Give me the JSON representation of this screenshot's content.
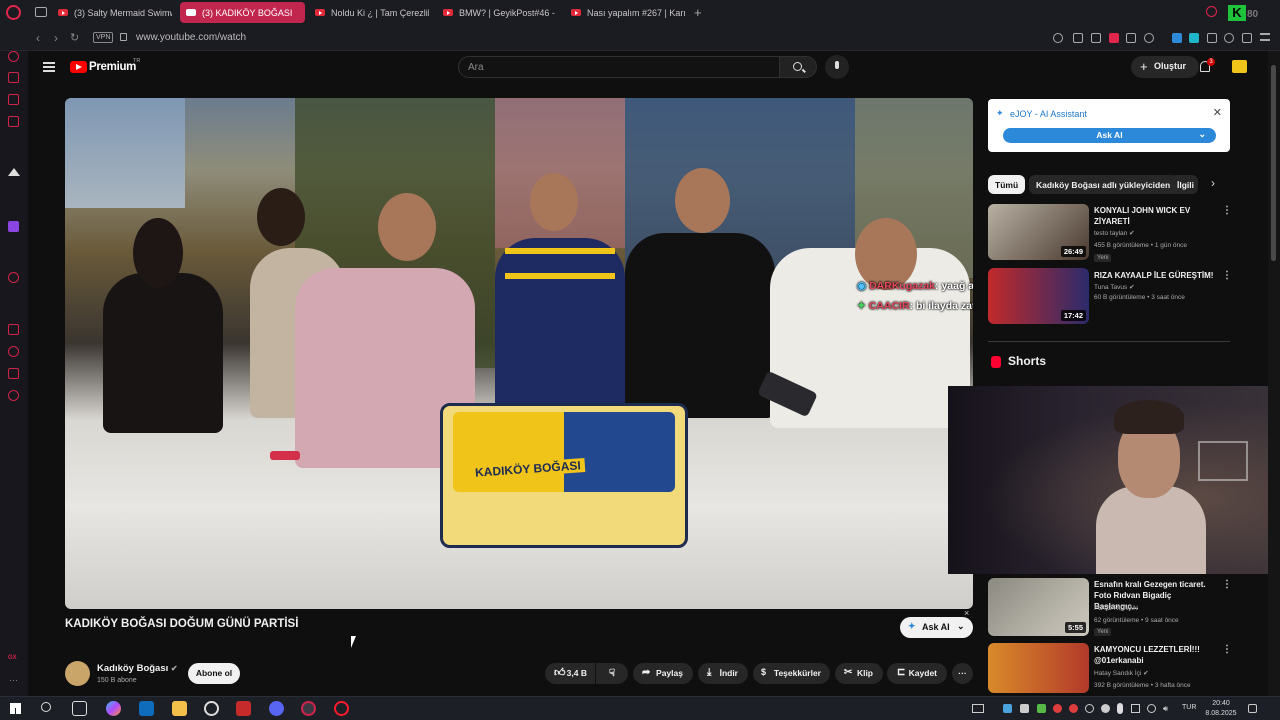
{
  "browser": {
    "tabs": [
      {
        "label": "(3) Salty Mermaid Swimw",
        "active": false
      },
      {
        "label": "(3) KADIKÖY BOĞASI",
        "active": true
      },
      {
        "label": "Noldu Ki ¿ | Tam Çerezlik",
        "active": false
      },
      {
        "label": "BMW? | GeyikPost#46 - Y",
        "active": false
      },
      {
        "label": "Nası yapalım #267 | Karış",
        "active": false
      }
    ],
    "vpn_label": "VPN",
    "url": "www.youtube.com/watch"
  },
  "youtube": {
    "logo_text": "Premium",
    "logo_region": "TR",
    "search_placeholder": "Ara",
    "create_label": "Oluştur",
    "notification_count": "3"
  },
  "video": {
    "title": "KADIKÖY BOĞASI DOĞUM GÜNÜ PARTİSİ",
    "cake_text": "KADIKÖY BOĞASI",
    "chat": [
      {
        "user": "DARKugazak",
        "message": ": yaağ ali koç"
      },
      {
        "user": "CAACIR",
        "message": ": bi ilayda zaten misafir amk müstafası"
      }
    ],
    "ask_ai_label": "Ask AI"
  },
  "channel": {
    "name": "Kadıköy Boğası",
    "subscribers": "150 B abone",
    "subscribe_label": "Abone ol"
  },
  "actions": {
    "likes": "3,4 B",
    "share": "Paylaş",
    "download": "İndir",
    "thanks": "Teşekkürler",
    "clip": "Klip",
    "save": "Kaydet"
  },
  "ejoy": {
    "title": "eJOY - AI Assistant",
    "button": "Ask AI"
  },
  "chips": [
    "Tümü",
    "Kadıköy Boğası adlı yükleyiciden",
    "İlgili"
  ],
  "recommendations": [
    {
      "title": "KONYALI JOHN WICK EV ZİYARETİ",
      "channel": "testo taylan",
      "meta": "455 B görüntüleme • 1 gün önce",
      "badge": "Yeni",
      "duration": "26:49"
    },
    {
      "title": "RIZA KAYAALP İLE GÜREŞTİM!",
      "channel": "Tuna Tavus",
      "meta": "60 B görüntüleme • 3 saat önce",
      "badge": "",
      "duration": "17:42"
    },
    {
      "title": "Esnafın kralı Gezegen ticaret. Foto Rıdvan Bigadiç Başlangıç...",
      "channel": "FOTO RIDVAN",
      "meta": "62 görüntüleme • 9 saat önce",
      "badge": "Yeni",
      "duration": "5:55"
    },
    {
      "title": "KAMYONCU LEZZETLERİ!!! @01erkanabi",
      "channel": "Hatay Sandık İçi",
      "meta": "392 B görüntüleme • 3 hafta önce",
      "badge": "",
      "duration": ""
    }
  ],
  "shorts_label": "Shorts",
  "taskbar": {
    "lang": "TUR",
    "time": "20:40",
    "date": "8.08.2025"
  },
  "colors": {
    "opera_red": "#d2244a",
    "active_tab": "#c1274e",
    "yt_red": "#ff0000",
    "ejoy_blue": "#2c88d9"
  }
}
